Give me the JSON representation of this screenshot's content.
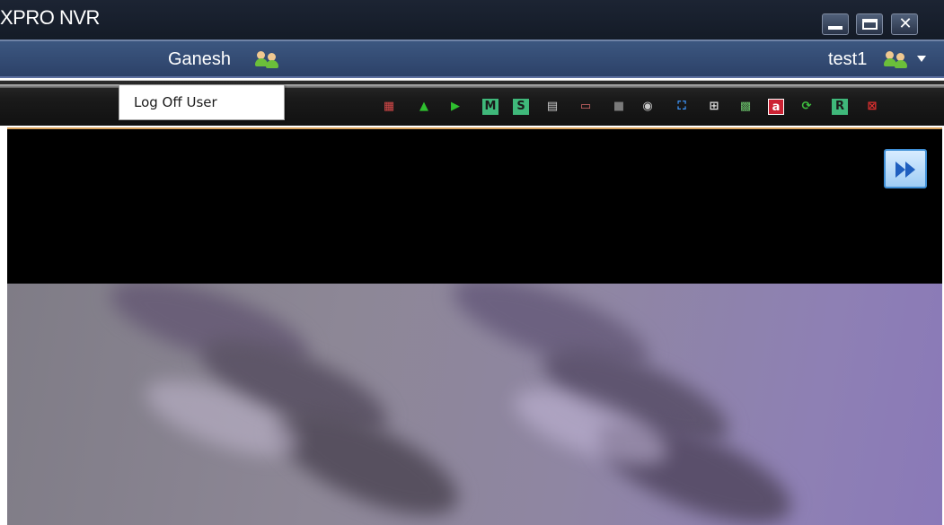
{
  "window": {
    "title": "XPRO NVR",
    "minimize_icon": "minimize-icon",
    "maximize_icon": "maximize-icon",
    "close_icon": "close-icon",
    "close_glyph": "✕"
  },
  "userbar": {
    "logged_user": "Ganesh",
    "current_user": "test1",
    "users_icon": "users-icon",
    "dropdown_icon": "chevron-down-icon"
  },
  "menu": {
    "logoff_label": "Log Off User"
  },
  "toolbar": {
    "icons": [
      {
        "name": "chart-icon",
        "glyph": "▦",
        "color": "#d94a4a"
      },
      {
        "name": "sequence-icon",
        "glyph": "▲",
        "color": "#2fbf2f"
      },
      {
        "name": "play-icon",
        "glyph": "▶",
        "color": "#2fbf2f"
      },
      {
        "name": "m-icon",
        "glyph": "M",
        "color": "#3fb87a"
      },
      {
        "name": "s-icon",
        "glyph": "S",
        "color": "#3fb87a"
      },
      {
        "name": "document-icon",
        "glyph": "▤",
        "color": "#cfcfcf"
      },
      {
        "name": "calendar-icon",
        "glyph": "▭",
        "color": "#d46a6a"
      },
      {
        "name": "save-icon",
        "glyph": "■",
        "color": "#7a7a7a"
      },
      {
        "name": "camera-icon",
        "glyph": "◉",
        "color": "#c8c8c8"
      },
      {
        "name": "fullscreen-icon",
        "glyph": "⛶",
        "color": "#3f98ff"
      },
      {
        "name": "grid-icon",
        "glyph": "⊞",
        "color": "#e0e0e0"
      },
      {
        "name": "map-icon",
        "glyph": "▩",
        "color": "#6abf6a"
      },
      {
        "name": "a-icon",
        "glyph": "a",
        "color": "#ffffff"
      },
      {
        "name": "refresh-icon",
        "glyph": "⟳",
        "color": "#3fbf3f"
      },
      {
        "name": "r-icon",
        "glyph": "R",
        "color": "#3fb87a"
      },
      {
        "name": "layout-icon",
        "glyph": "⊠",
        "color": "#e03030"
      }
    ]
  },
  "viewer": {
    "next_icon": "fast-forward-icon"
  },
  "colors": {
    "titlebar": "#1c2433",
    "userbar": "#3c5780",
    "toolbar": "#1a1a1a",
    "video_border": "#d7a15c",
    "video_feed": "#8d8796"
  }
}
